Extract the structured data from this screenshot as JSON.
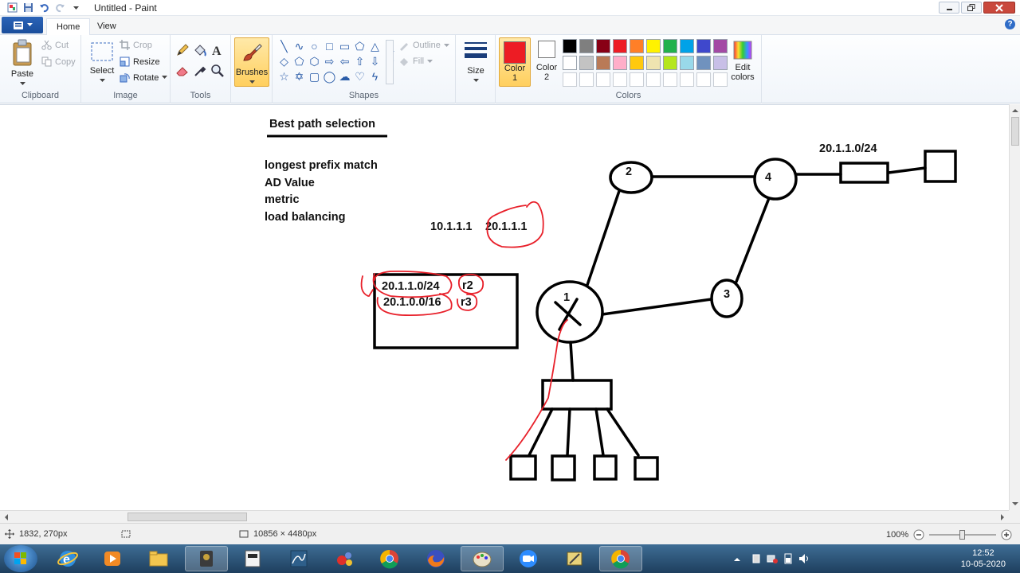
{
  "window": {
    "title": "Untitled - Paint"
  },
  "ribbon": {
    "tabs": [
      {
        "label": "Home"
      },
      {
        "label": "View"
      }
    ],
    "clipboard": {
      "label": "Clipboard",
      "paste": "Paste",
      "cut": "Cut",
      "copy": "Copy"
    },
    "image": {
      "label": "Image",
      "select": "Select",
      "crop": "Crop",
      "resize": "Resize",
      "rotate": "Rotate"
    },
    "tools": {
      "label": "Tools"
    },
    "brushes": {
      "label": "Brushes"
    },
    "shapes": {
      "label": "Shapes",
      "outline": "Outline",
      "fill": "Fill"
    },
    "size": {
      "label": "Size"
    },
    "colors": {
      "label": "Colors",
      "color1_line1": "Color",
      "color1_line2": "1",
      "color2_line1": "Color",
      "color2_line2": "2",
      "edit_line1": "Edit",
      "edit_line2": "colors",
      "color1_value": "#ed1c24",
      "color2_value": "#ffffff",
      "palette": [
        "#000000",
        "#7f7f7f",
        "#880015",
        "#ed1c24",
        "#ff7f27",
        "#fff200",
        "#22b14c",
        "#00a2e8",
        "#3f48cc",
        "#a349a4",
        "#ffffff",
        "#c3c3c3",
        "#b97a57",
        "#ffaec9",
        "#ffc90e",
        "#efe4b0",
        "#b5e61d",
        "#99d9ea",
        "#7092be",
        "#c8bfe7",
        "#ffffff",
        "#ffffff",
        "#ffffff",
        "#ffffff",
        "#ffffff",
        "#ffffff",
        "#ffffff",
        "#ffffff",
        "#ffffff",
        "#ffffff"
      ]
    }
  },
  "canvas": {
    "heading": "Best path selection",
    "criteria": [
      "longest prefix match",
      "AD Value",
      "metric",
      "load balancing"
    ],
    "ip_left": "10.1.1.1",
    "ip_right": "20.1.1.1",
    "route_table": [
      {
        "prefix": "20.1.1.0/24",
        "next_hop": "r2"
      },
      {
        "prefix": "20.1.0.0/16",
        "next_hop": "r3"
      }
    ],
    "network_label": "20.1.1.0/24",
    "routers": [
      "1",
      "2",
      "3",
      "4"
    ]
  },
  "status": {
    "cursor": "1832, 270px",
    "image_size": "10856 × 4480px",
    "zoom": "100%"
  },
  "taskbar": {
    "time": "12:52",
    "date": "10-05-2020"
  }
}
